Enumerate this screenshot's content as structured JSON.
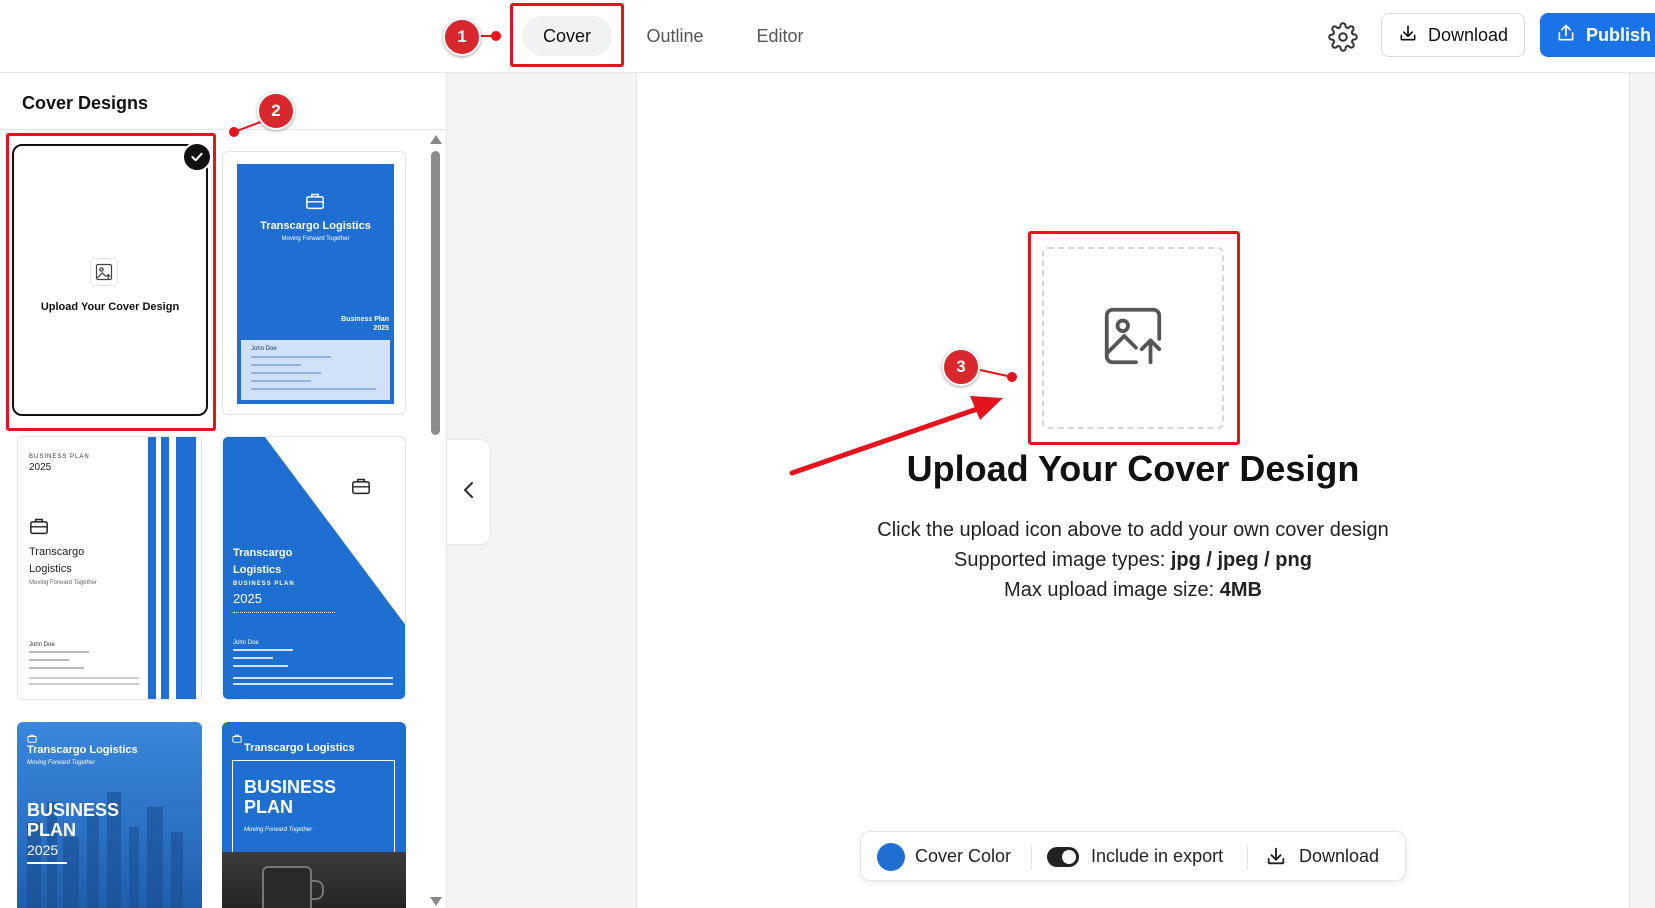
{
  "topbar": {
    "tabs": [
      {
        "label": "Cover",
        "active": true
      },
      {
        "label": "Outline",
        "active": false
      },
      {
        "label": "Editor",
        "active": false
      }
    ],
    "download_label": "Download",
    "publish_label": "Publish"
  },
  "sidebar": {
    "title": "Cover Designs",
    "thumb1": {
      "label": "Upload Your Cover Design",
      "selected": true
    },
    "thumb2": {
      "company": "Transcargo Logistics",
      "tagline": "Moving Forward Together",
      "plan": "Business Plan",
      "year": "2025",
      "contact_name": "John Doe"
    },
    "thumb3": {
      "plan": "BUSINESS PLAN",
      "year": "2025",
      "company_line1": "Transcargo",
      "company_line2": "Logistics",
      "tagline": "Moving Forward Together",
      "contact_name": "John Doe"
    },
    "thumb4": {
      "company_line1": "Transcargo",
      "company_line2": "Logistics",
      "plan": "BUSINESS PLAN",
      "year": "2025",
      "contact_name": "John Doe"
    },
    "thumb5": {
      "company": "Transcargo Logistics",
      "tagline": "Moving Forward Together",
      "plan_line1": "BUSINESS",
      "plan_line2": "PLAN",
      "year": "2025"
    },
    "thumb6": {
      "company": "Transcargo Logistics",
      "plan_line1": "BUSINESS",
      "plan_line2": "PLAN",
      "tagline": "Moving Forward Together"
    }
  },
  "canvas": {
    "heading": "Upload Your Cover Design",
    "line1": "Click the upload icon above to add your own cover design",
    "line2_prefix": "Supported image types: ",
    "line2_value": "jpg / jpeg / png",
    "line3_prefix": "Max upload image size: ",
    "line3_value": "4MB"
  },
  "toolbar": {
    "cover_color_label": "Cover Color",
    "include_label": "Include in export",
    "include_enabled": true,
    "download_label": "Download"
  },
  "annotations": [
    "1",
    "2",
    "3"
  ],
  "colors": {
    "accent": "#1a73e8",
    "cover_blue": "#1e6fd1",
    "annotation_red": "#e5141c"
  },
  "icons": [
    "settings-gear-icon",
    "download-icon",
    "share-upload-icon",
    "image-upload-icon",
    "check-icon",
    "briefcase-icon",
    "chevron-left-icon"
  ]
}
